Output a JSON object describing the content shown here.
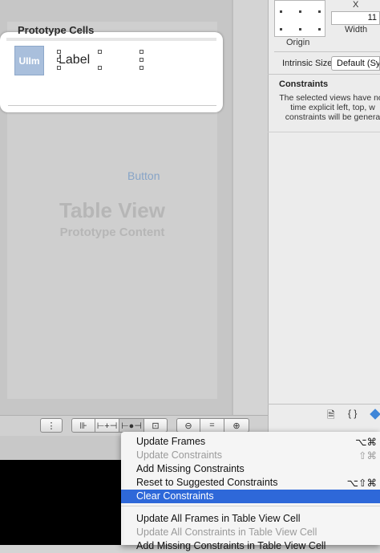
{
  "canvas": {
    "prototype_cells_label": "Prototype Cells",
    "cell": {
      "image_placeholder": "UIIm",
      "label_text": "Label"
    },
    "button_text": "Button",
    "table_view_title": "Table View",
    "table_view_subtitle": "Prototype Content"
  },
  "inspector": {
    "x_label": "X",
    "x_value": "11",
    "origin_label": "Origin",
    "width_label": "Width",
    "intrinsic_size_label": "Intrinsic Size",
    "intrinsic_size_value": "Default (Sy",
    "constraints_title": "Constraints",
    "constraints_message_lines": [
      "The selected views have no",
      "time explicit left, top, w",
      "constraints will be genera"
    ],
    "toolbar_icons": [
      "file-icon",
      "braces-icon",
      "object-library-icon"
    ]
  },
  "canvas_toolbar": {
    "buttons": [
      {
        "name": "issues-button",
        "glyph": "⫶"
      },
      {
        "name": "align-button",
        "glyph": "⊫"
      },
      {
        "name": "pin-button",
        "glyph": "⊢+⊣"
      },
      {
        "name": "resolve-issues-button",
        "glyph": "⊢●⊣"
      },
      {
        "name": "resizing-button",
        "glyph": "⊡"
      },
      {
        "name": "zoom-out-button",
        "glyph": "−"
      },
      {
        "name": "zoom-actual-button",
        "glyph": "="
      },
      {
        "name": "zoom-in-button",
        "glyph": "+"
      }
    ]
  },
  "menu": {
    "items": [
      {
        "label": "Update Frames",
        "shortcut": "⌥⌘",
        "state": "enabled"
      },
      {
        "label": "Update Constraints",
        "shortcut": "⇧⌘",
        "state": "disabled"
      },
      {
        "label": "Add Missing Constraints",
        "shortcut": "",
        "state": "enabled"
      },
      {
        "label": "Reset to Suggested Constraints",
        "shortcut": "⌥⇧⌘",
        "state": "enabled"
      },
      {
        "label": "Clear Constraints",
        "shortcut": "",
        "state": "selected"
      },
      {
        "label": "Update All Frames in Table View Cell",
        "shortcut": "",
        "state": "enabled"
      },
      {
        "label": "Update All Constraints in Table View Cell",
        "shortcut": "",
        "state": "disabled"
      },
      {
        "label": "Add Missing Constraints in Table View Cell",
        "shortcut": "",
        "state": "enabled"
      }
    ]
  },
  "colors": {
    "menu_highlight": "#2e68d9",
    "button_blue": "#87a4c7",
    "image_view_fill": "#a9bfdc"
  }
}
